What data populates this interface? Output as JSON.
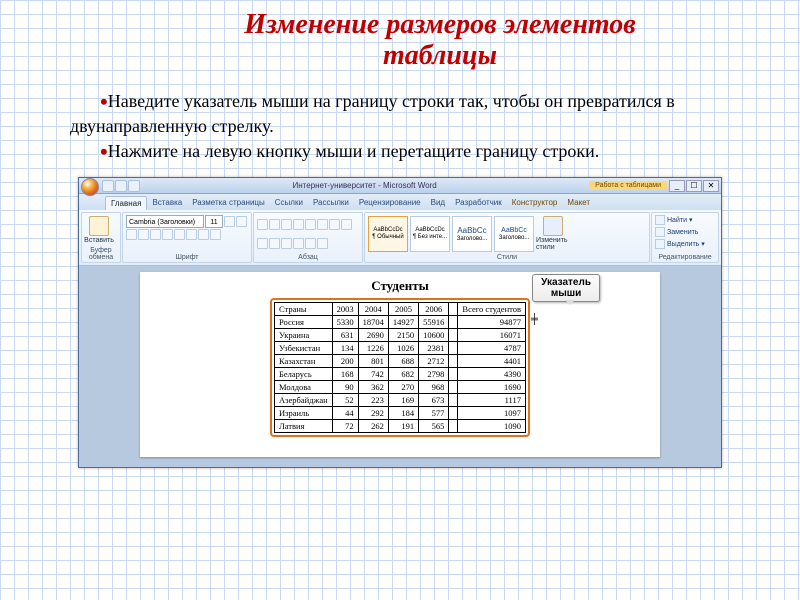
{
  "slide": {
    "title": "Изменение размеров элементов таблицы",
    "bullet1": "Наведите указатель мыши на границу строки так, чтобы он превратился в двунаправленную стрелку.",
    "bullet2": "Нажмите на левую кнопку мыши и перетащите границу строки."
  },
  "word": {
    "titlebar": "Интернет-университет - Microsoft Word",
    "context_tab_group": "Работа с таблицами",
    "tabs": {
      "home": "Главная",
      "insert": "Вставка",
      "layout": "Разметка страницы",
      "refs": "Ссылки",
      "mail": "Рассылки",
      "review": "Рецензирование",
      "view": "Вид",
      "dev": "Разработчик",
      "design": "Конструктор",
      "tlayout": "Макет"
    },
    "groups": {
      "clipboard": "Буфер обмена",
      "paste": "Вставить",
      "font": "Шрифт",
      "paragraph": "Абзац",
      "styles": "Стили",
      "styles_btn": "Изменить стили",
      "editing": "Редактирование",
      "find": "Найти",
      "replace": "Заменить",
      "select": "Выделить"
    },
    "font_name": "Cambria (Заголовки)",
    "font_size": "11",
    "style_preview": "AaBbCcDc",
    "style_preview_big": "AaBbCc",
    "style_names": {
      "normal": "¶ Обычный",
      "nospace": "¶ Без инте...",
      "h1": "Заголово...",
      "h2": "Заголово..."
    }
  },
  "callout": {
    "line1": "Указатель",
    "line2": "мыши"
  },
  "table": {
    "title": "Студенты",
    "headers": [
      "Страны",
      "2003",
      "2004",
      "2005",
      "2006",
      "",
      "Всего студентов"
    ],
    "rows": [
      [
        "Россия",
        "5330",
        "18704",
        "14927",
        "55916",
        "",
        "94877"
      ],
      [
        "Украина",
        "631",
        "2690",
        "2150",
        "10600",
        "",
        "16071"
      ],
      [
        "Узбекистан",
        "134",
        "1226",
        "1026",
        "2381",
        "",
        "4787"
      ],
      [
        "Казахстан",
        "200",
        "801",
        "688",
        "2712",
        "",
        "4401"
      ],
      [
        "Беларусь",
        "168",
        "742",
        "682",
        "2798",
        "",
        "4390"
      ],
      [
        "Молдова",
        "90",
        "362",
        "270",
        "968",
        "",
        "1690"
      ],
      [
        "Азербайджан",
        "52",
        "223",
        "169",
        "673",
        "",
        "1117"
      ],
      [
        "Израиль",
        "44",
        "292",
        "184",
        "577",
        "",
        "1097"
      ],
      [
        "Латвия",
        "72",
        "262",
        "191",
        "565",
        "",
        "1090"
      ]
    ]
  }
}
